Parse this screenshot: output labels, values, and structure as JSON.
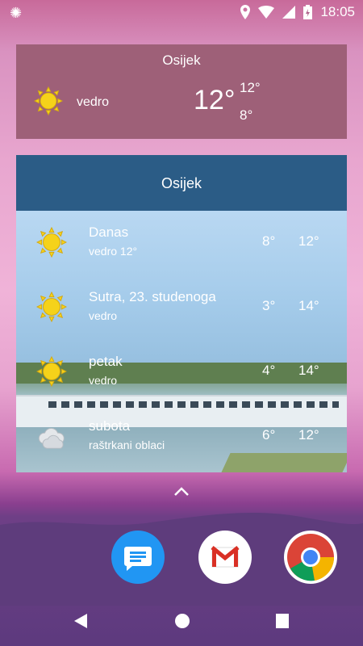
{
  "status_bar": {
    "time": "18:05"
  },
  "widget_current": {
    "city": "Osijek",
    "condition": "vedro",
    "temperature": "12°",
    "high": "12°",
    "low": "8°"
  },
  "widget_forecast": {
    "city": "Osijek",
    "days": [
      {
        "name": "Danas",
        "condition": "vedro   12°",
        "low": "8°",
        "high": "12°",
        "icon": "sun-icon"
      },
      {
        "name": "Sutra, 23. studenoga",
        "condition": "vedro",
        "low": "3°",
        "high": "14°",
        "icon": "sun-icon"
      },
      {
        "name": "petak",
        "condition": "vedro",
        "low": "4°",
        "high": "14°",
        "icon": "sun-icon"
      },
      {
        "name": "subota",
        "condition": "raštrkani oblaci",
        "low": "6°",
        "high": "12°",
        "icon": "cloud-icon"
      }
    ]
  },
  "dock": {
    "apps": [
      "messages-icon",
      "gmail-icon",
      "chrome-icon"
    ]
  },
  "colors": {
    "widget_current_bg": "#9e6078",
    "widget_header_bg": "#2b5c86",
    "sun_yellow": "#f5d21a"
  }
}
